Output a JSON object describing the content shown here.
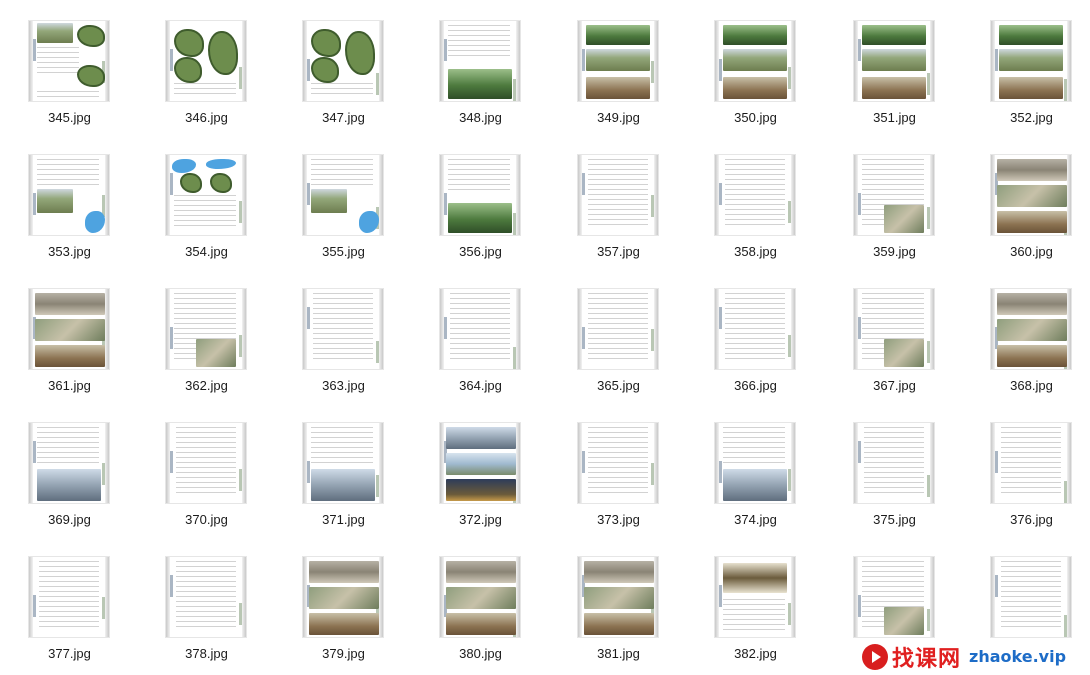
{
  "files": [
    {
      "name": "345.jpg",
      "style": "a"
    },
    {
      "name": "346.jpg",
      "style": "b"
    },
    {
      "name": "347.jpg",
      "style": "b"
    },
    {
      "name": "348.jpg",
      "style": "c"
    },
    {
      "name": "349.jpg",
      "style": "d"
    },
    {
      "name": "350.jpg",
      "style": "d"
    },
    {
      "name": "351.jpg",
      "style": "d"
    },
    {
      "name": "352.jpg",
      "style": "d"
    },
    {
      "name": "353.jpg",
      "style": "e"
    },
    {
      "name": "354.jpg",
      "style": "f"
    },
    {
      "name": "355.jpg",
      "style": "e"
    },
    {
      "name": "356.jpg",
      "style": "c"
    },
    {
      "name": "357.jpg",
      "style": "t"
    },
    {
      "name": "358.jpg",
      "style": "t"
    },
    {
      "name": "359.jpg",
      "style": "g"
    },
    {
      "name": "360.jpg",
      "style": "h"
    },
    {
      "name": "361.jpg",
      "style": "h"
    },
    {
      "name": "362.jpg",
      "style": "g"
    },
    {
      "name": "363.jpg",
      "style": "t"
    },
    {
      "name": "364.jpg",
      "style": "t"
    },
    {
      "name": "365.jpg",
      "style": "t"
    },
    {
      "name": "366.jpg",
      "style": "t"
    },
    {
      "name": "367.jpg",
      "style": "g"
    },
    {
      "name": "368.jpg",
      "style": "h"
    },
    {
      "name": "369.jpg",
      "style": "i"
    },
    {
      "name": "370.jpg",
      "style": "t"
    },
    {
      "name": "371.jpg",
      "style": "i"
    },
    {
      "name": "372.jpg",
      "style": "j"
    },
    {
      "name": "373.jpg",
      "style": "t"
    },
    {
      "name": "374.jpg",
      "style": "i"
    },
    {
      "name": "375.jpg",
      "style": "t"
    },
    {
      "name": "376.jpg",
      "style": "t"
    },
    {
      "name": "377.jpg",
      "style": "t"
    },
    {
      "name": "378.jpg",
      "style": "t"
    },
    {
      "name": "379.jpg",
      "style": "h"
    },
    {
      "name": "380.jpg",
      "style": "h"
    },
    {
      "name": "381.jpg",
      "style": "h"
    },
    {
      "name": "382.jpg",
      "style": "k"
    },
    {
      "name": "",
      "style": "g"
    },
    {
      "name": "",
      "style": "t"
    }
  ],
  "watermark": {
    "text": "找课网",
    "url": "zhaoke.vip"
  }
}
